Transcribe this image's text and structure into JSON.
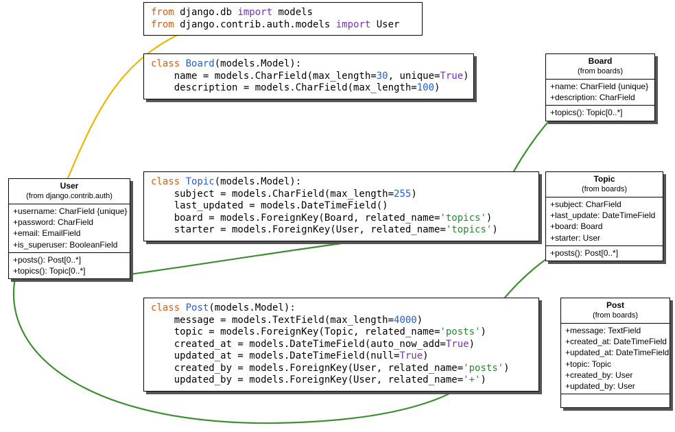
{
  "code": {
    "import_from1a": "from",
    "import_mod1": " django.db ",
    "import_kw1": "import",
    "import_name1": " models",
    "import_from2a": "from",
    "import_mod2": " django.contrib.auth.models ",
    "import_kw2": "import",
    "import_name2": " User",
    "board": {
      "class_kw": "class",
      "name": " Board",
      "bases": "(models.Model):",
      "l1a": "    name = models.CharField(max_length=",
      "l1n": "30",
      "l1b": ", unique=",
      "l1t": "True",
      "l1c": ")",
      "l2a": "    description = models.CharField(max_length=",
      "l2n": "100",
      "l2b": ")"
    },
    "topic": {
      "class_kw": "class",
      "name": " Topic",
      "bases": "(models.Model):",
      "l1a": "    subject = models.CharField(max_length=",
      "l1n": "255",
      "l1b": ")",
      "l2": "    last_updated = models.DateTimeField()",
      "l3a": "    board = models.ForeignKey(Board, related_name=",
      "l3s": "'topics'",
      "l3b": ")",
      "l4a": "    starter = models.ForeignKey(User, related_name=",
      "l4s": "'topics'",
      "l4b": ")"
    },
    "post": {
      "class_kw": "class",
      "name": " Post",
      "bases": "(models.Model):",
      "l1a": "    message = models.TextField(max_length=",
      "l1n": "4000",
      "l1b": ")",
      "l2a": "    topic = models.ForeignKey(Topic, related_name=",
      "l2s": "'posts'",
      "l2b": ")",
      "l3a": "    created_at = models.DateTimeField(auto_now_add=",
      "l3t": "True",
      "l3b": ")",
      "l4a": "    updated_at = models.DateTimeField(null=",
      "l4t": "True",
      "l4b": ")",
      "l5a": "    created_by = models.ForeignKey(User, related_name=",
      "l5s": "'posts'",
      "l5b": ")",
      "l6a": "    updated_by = models.ForeignKey(User, related_name=",
      "l6s": "'+'",
      "l6b": ")"
    }
  },
  "uml": {
    "user": {
      "title": "User",
      "sub": "(from django.contrib.auth)",
      "attrs": [
        "+username: CharField {unique}",
        "+password: CharField",
        "+email: EmailField",
        "+is_superuser: BooleanField"
      ],
      "ops": [
        "+posts(): Post[0..*]",
        "+topics(): Topic[0..*]"
      ]
    },
    "board": {
      "title": "Board",
      "sub": "(from boards)",
      "attrs": [
        "+name: CharField {unique}",
        "+description: CharField"
      ],
      "ops": [
        "+topics(): Topic[0..*]"
      ]
    },
    "topic": {
      "title": "Topic",
      "sub": "(from boards)",
      "attrs": [
        "+subject: CharField",
        "+last_update: DateTimeField",
        "+board: Board",
        "+starter: User"
      ],
      "ops": [
        "+posts(): Post[0..*]"
      ]
    },
    "post": {
      "title": "Post",
      "sub": "(from boards)",
      "attrs": [
        "+message: TextField",
        "+created_at: DateTimeField",
        "+updated_at: DateTimeField",
        "+topic: Topic",
        "+created_by: User",
        "+updated_by: User"
      ]
    }
  },
  "colors": {
    "yellow": "#f0b400",
    "green": "#3a8f2e"
  }
}
